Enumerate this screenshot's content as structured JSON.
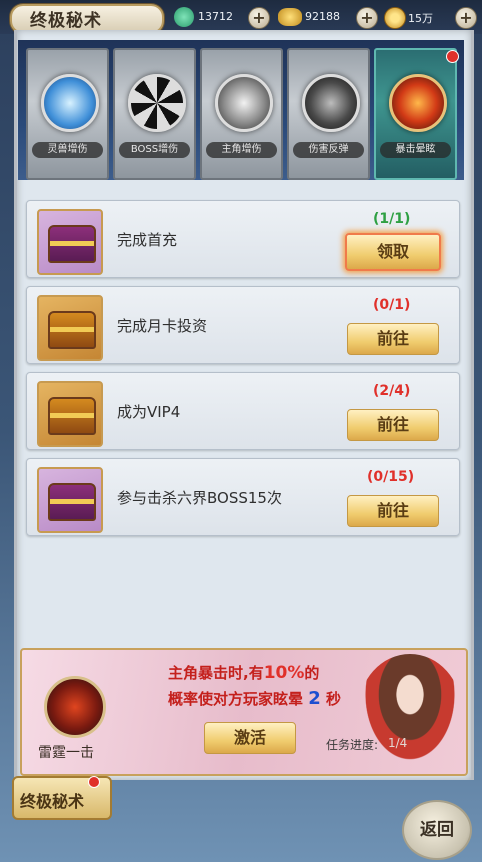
{
  "header": {
    "title": "终极秘术",
    "resources": [
      {
        "icon": "jade-coin-icon",
        "value": "13712"
      },
      {
        "icon": "gold-ingot-icon",
        "value": "92188"
      },
      {
        "icon": "gold-coin-icon",
        "value": "15万"
      }
    ]
  },
  "skills": [
    {
      "label": "灵兽增伤",
      "icon": "crystal-icon",
      "active": false
    },
    {
      "label": "BOSS增伤",
      "icon": "vortex-icon",
      "active": false
    },
    {
      "label": "主角增伤",
      "icon": "ox-demon-icon",
      "active": false
    },
    {
      "label": "伤害反弹",
      "icon": "beast-mask-icon",
      "active": false
    },
    {
      "label": "暴击晕眩",
      "icon": "fire-demon-icon",
      "active": true
    }
  ],
  "tasks": [
    {
      "name": "完成首充",
      "progress": "(1/1)",
      "button": "领取",
      "chest": "purple",
      "completed": true
    },
    {
      "name": "完成月卡投资",
      "progress": "(0/1)",
      "button": "前往",
      "chest": "gold",
      "completed": false
    },
    {
      "name": "成为VIP4",
      "progress": "(2/4)",
      "button": "前往",
      "chest": "gold",
      "completed": false
    },
    {
      "name": "参与击杀六界BOSS15次",
      "progress": "(0/15)",
      "button": "前往",
      "chest": "purple",
      "completed": false
    }
  ],
  "banner": {
    "skill_name": "雷霆一击",
    "desc_line1_a": "主角暴击时,有",
    "desc_line1_hl": "10%",
    "desc_line1_b": "的",
    "desc_line2_a": "概率使对方玩家眩晕",
    "desc_line2_hl": "2",
    "desc_line2_b": "秒",
    "activate_label": "激活",
    "progress_label": "任务进度:",
    "progress_value": "1/4"
  },
  "bottom": {
    "tab_label": "终极秘术",
    "back_label": "返回"
  },
  "colors": {
    "progress_done": "#2ea043",
    "progress_pending": "#e0302a",
    "accent_red": "#c4201c"
  }
}
